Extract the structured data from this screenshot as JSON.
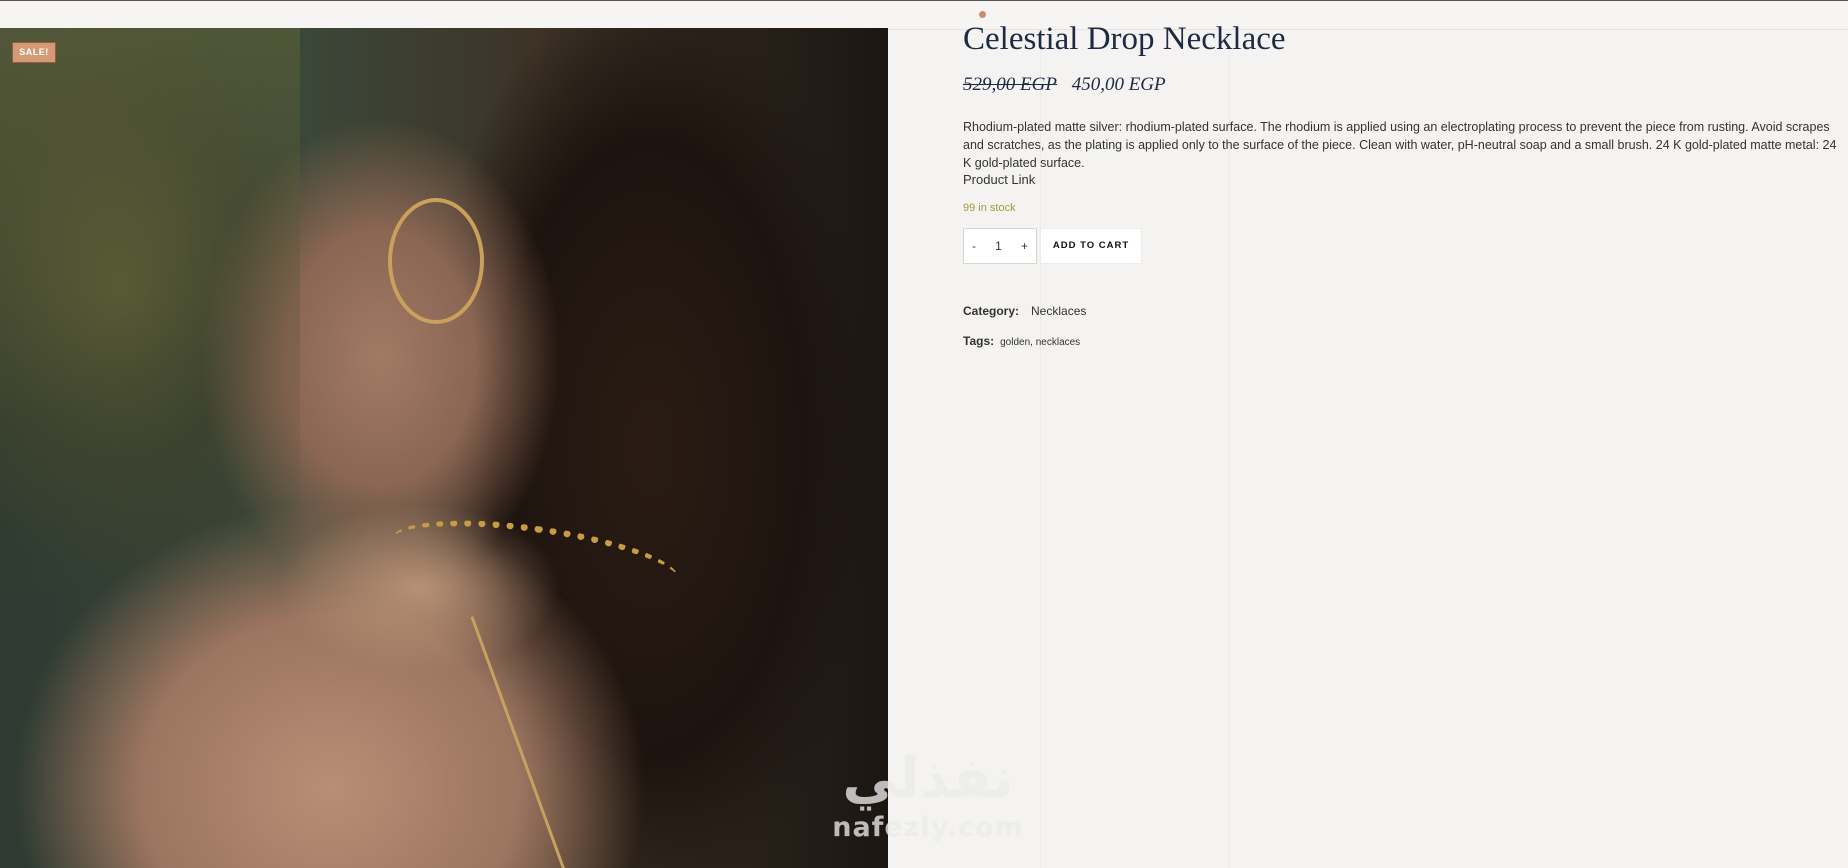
{
  "sale_badge": "SALE!",
  "product": {
    "title": "Celestial Drop Necklace",
    "old_price": "529,00 EGP",
    "price": "450,00 EGP",
    "description": "Rhodium-plated matte silver: rhodium-plated surface. The rhodium is applied using an electroplating process to prevent the piece from rusting. Avoid scrapes and scratches, as the plating is applied only to the surface of the piece. Clean with water, pH-neutral soap and a small brush. 24 K gold-plated matte metal: 24 K gold-plated surface.",
    "product_link": "Product Link",
    "stock": "99 in stock"
  },
  "quantity": {
    "minus": "-",
    "value": "1",
    "plus": "+"
  },
  "cart": {
    "add_label": "ADD TO CART"
  },
  "meta": {
    "category_label": "Category:",
    "category_value": "Necklaces",
    "tags_label": "Tags:",
    "tags": [
      "golden",
      "necklaces"
    ],
    "tag_separator": ", "
  },
  "watermark": {
    "arabic": "نفذلي",
    "latin": "nafezly.com"
  },
  "colors": {
    "sale_badge": "#d49a76",
    "title": "#1d2a44",
    "stock": "#9f9a3c",
    "background": "#f4f3f1"
  },
  "icons": [
    "indicator-dot"
  ]
}
